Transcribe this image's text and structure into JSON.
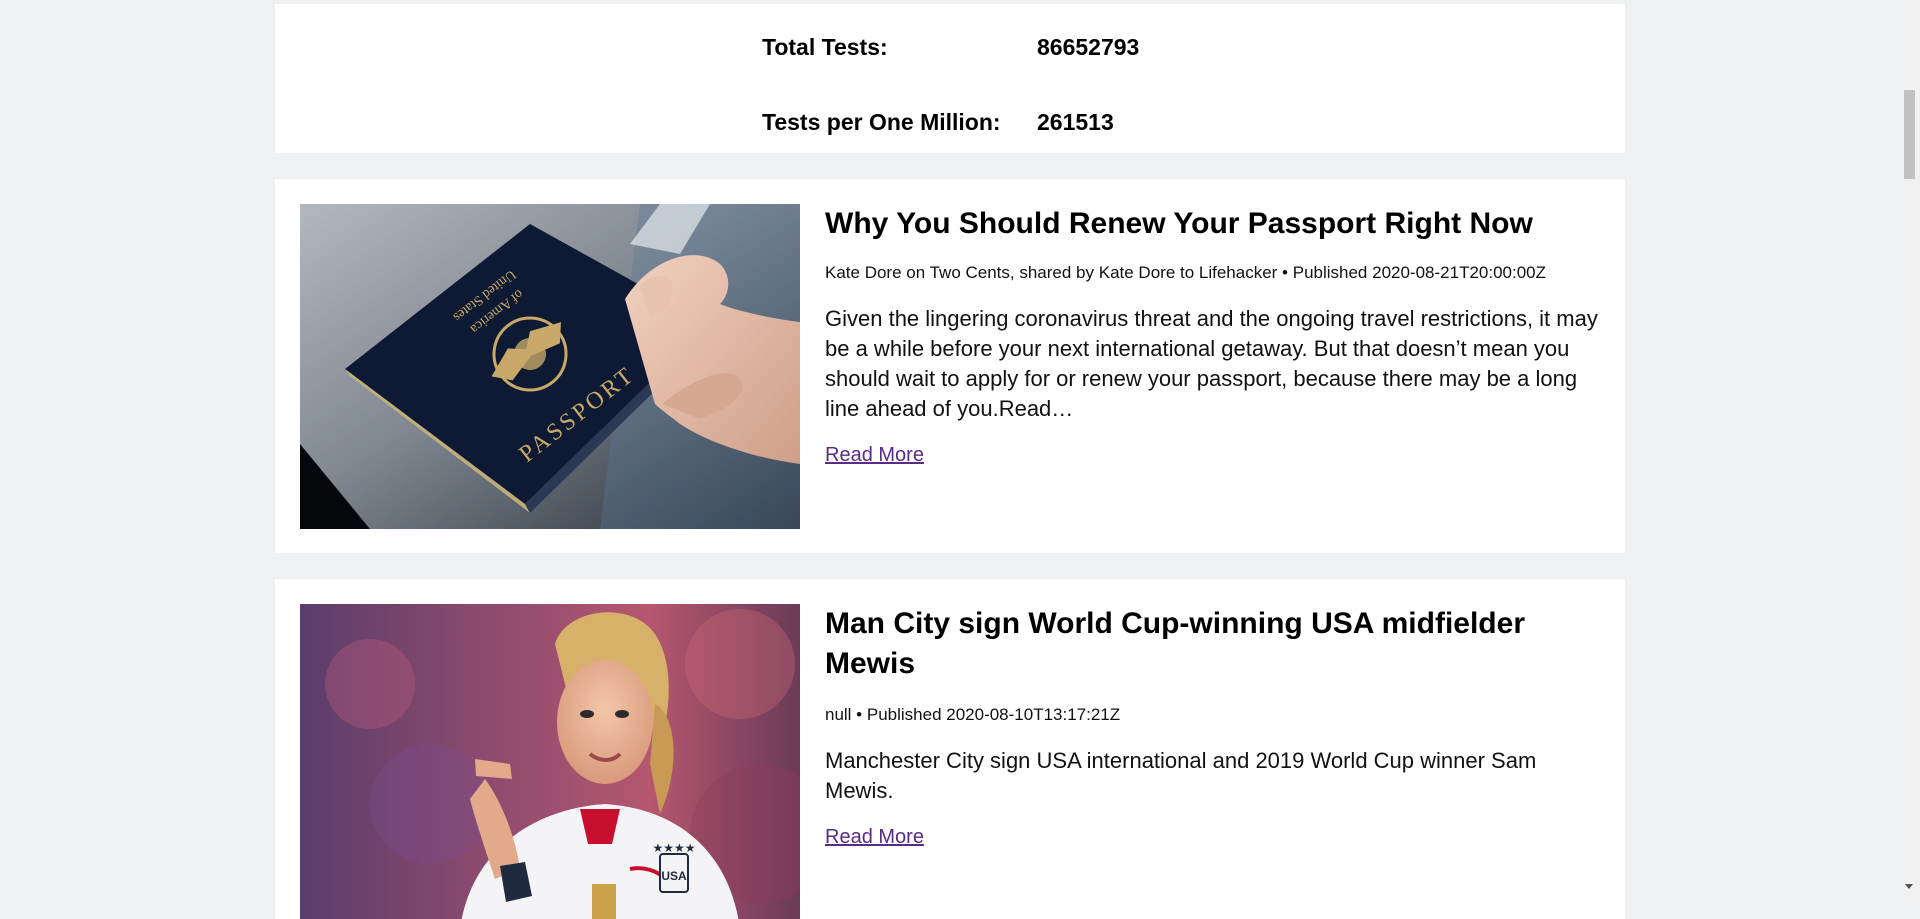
{
  "stats": {
    "total_tests_label": "Total Tests:",
    "total_tests_value": "86652793",
    "tests_per_million_label": "Tests per One Million:",
    "tests_per_million_value": "261513"
  },
  "articles": [
    {
      "title": "Why You Should Renew Your Passport Right Now",
      "meta": "Kate Dore on Two Cents, shared by Kate Dore to Lifehacker • Published 2020-08-21T20:00:00Z",
      "description": "Given the lingering coronavirus threat and the ongoing travel restrictions, it may be a while before your next international getaway. But that doesn’t mean you should wait to apply for or renew your passport, because there may be a long line ahead of you.Read…",
      "link": "Read More",
      "image_icon": "passport-photo"
    },
    {
      "title": "Man City sign World Cup-winning USA midfielder Mewis",
      "meta": "null • Published 2020-08-10T13:17:21Z",
      "description": "Manchester City sign USA international and 2019 World Cup winner Sam Mewis.",
      "link": "Read More",
      "image_icon": "soccer-player-photo"
    }
  ],
  "colors": {
    "background": "#eef0f2",
    "card": "#ffffff",
    "link_visited": "#5b2a86"
  }
}
